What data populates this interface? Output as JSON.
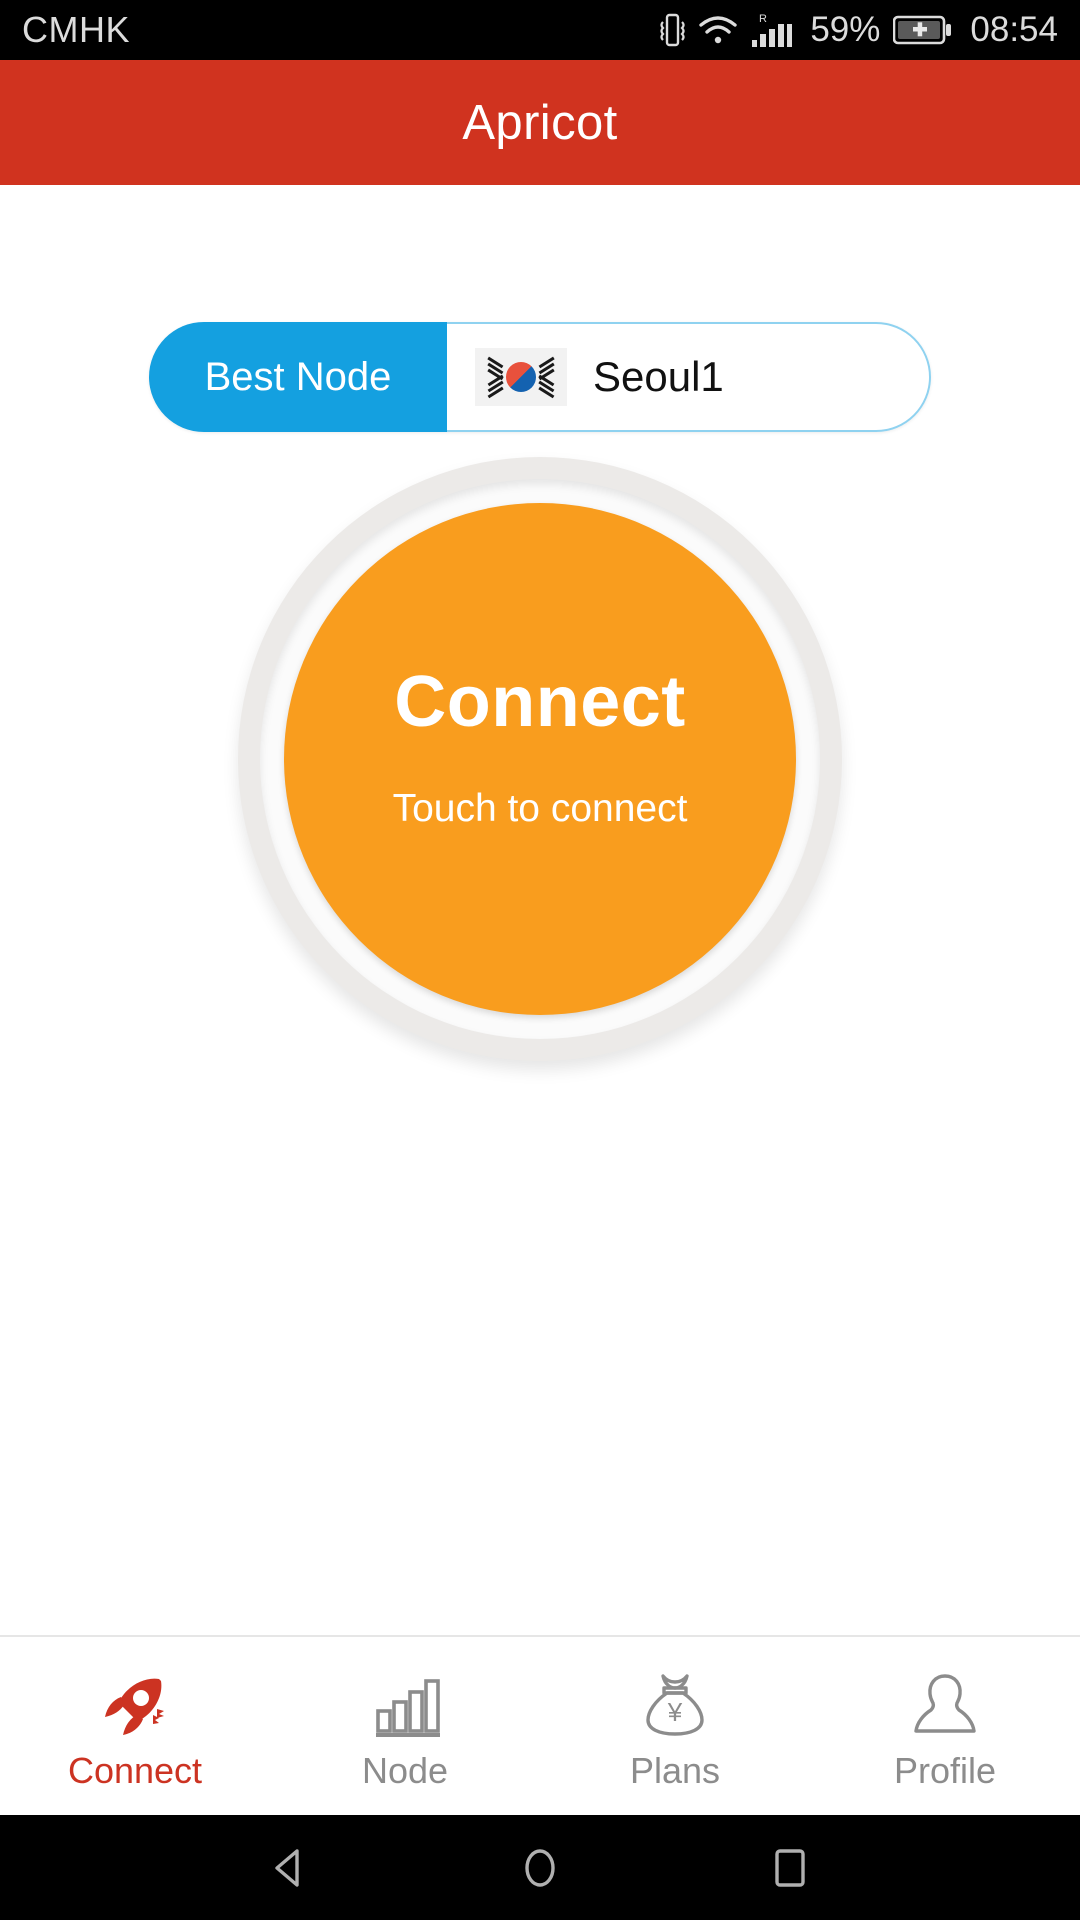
{
  "status_bar": {
    "carrier": "CMHK",
    "battery_percent": "59%",
    "clock": "08:54",
    "icons": [
      "vibrate-icon",
      "wifi-icon",
      "cellular-signal-roaming-icon",
      "battery-charging-icon"
    ],
    "roaming_label": "R",
    "background_color": "#000000",
    "text_color": "#dcdcdc"
  },
  "header": {
    "title": "Apricot",
    "background_color": "#d0331f",
    "text_color": "#ffffff"
  },
  "node_selector": {
    "mode_label": "Best Node",
    "mode_color": "#14a0e0",
    "flag": "south-korea-flag-icon",
    "node_name": "Seoul1",
    "border_color": "#8fd2f0"
  },
  "connect_button": {
    "label": "Connect",
    "sublabel": "Touch to connect",
    "color": "#f99d1e",
    "ring_color": "#eceae8",
    "text_color": "#ffffff"
  },
  "tab_bar": {
    "active_color": "#cc3322",
    "inactive_color": "#8c8c8c",
    "items": [
      {
        "label": "Connect",
        "icon": "rocket-icon",
        "active": true
      },
      {
        "label": "Node",
        "icon": "bar-chart-icon",
        "active": false
      },
      {
        "label": "Plans",
        "icon": "money-bag-yen-icon",
        "active": false
      },
      {
        "label": "Profile",
        "icon": "person-icon",
        "active": false
      }
    ]
  },
  "android_nav": {
    "buttons": [
      "back-icon",
      "home-icon",
      "recents-icon"
    ],
    "background_color": "#000000"
  }
}
